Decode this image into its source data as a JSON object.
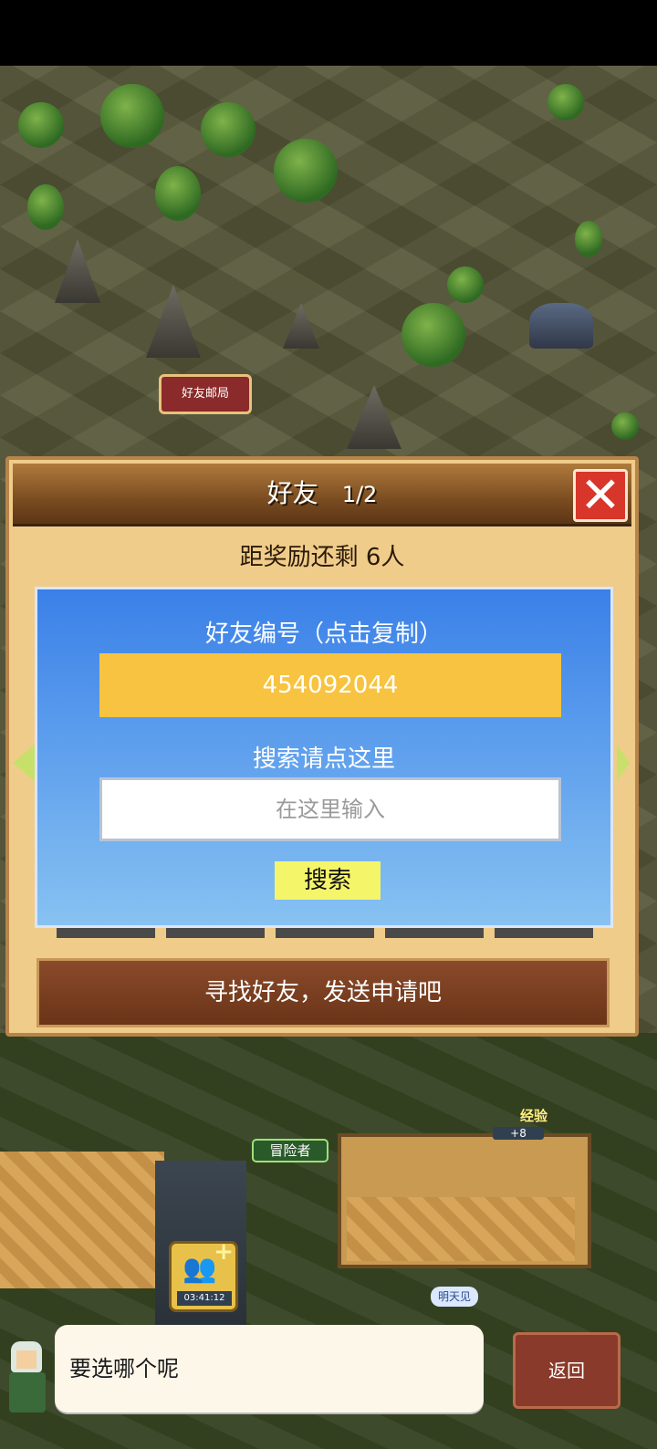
{
  "map": {
    "mailbox_label": "好友邮局",
    "adventurer_label": "冒险者",
    "exp_label": "经验",
    "exp_value": "+8",
    "badge_timer": "03:41:12",
    "tomorrow_label": "明天见"
  },
  "dialog": {
    "title": "好友",
    "page": "1/2",
    "close_glyph": "✕",
    "reward_text": "距奖励还剩 6人",
    "friend_code_label": "好友编号（点击复制）",
    "friend_code_value": "454092044",
    "search_label": "搜索请点这里",
    "search_placeholder": "在这里输入",
    "search_button": "搜索",
    "bottom_message": "寻找好友，发送申请吧"
  },
  "chat": {
    "message": "要选哪个呢",
    "back_button": "返回"
  },
  "colors": {
    "accent_yellow": "#f7c340",
    "panel_blue": "#3a80e8",
    "close_red": "#d8362a",
    "header_brown": "#7a4c20"
  }
}
